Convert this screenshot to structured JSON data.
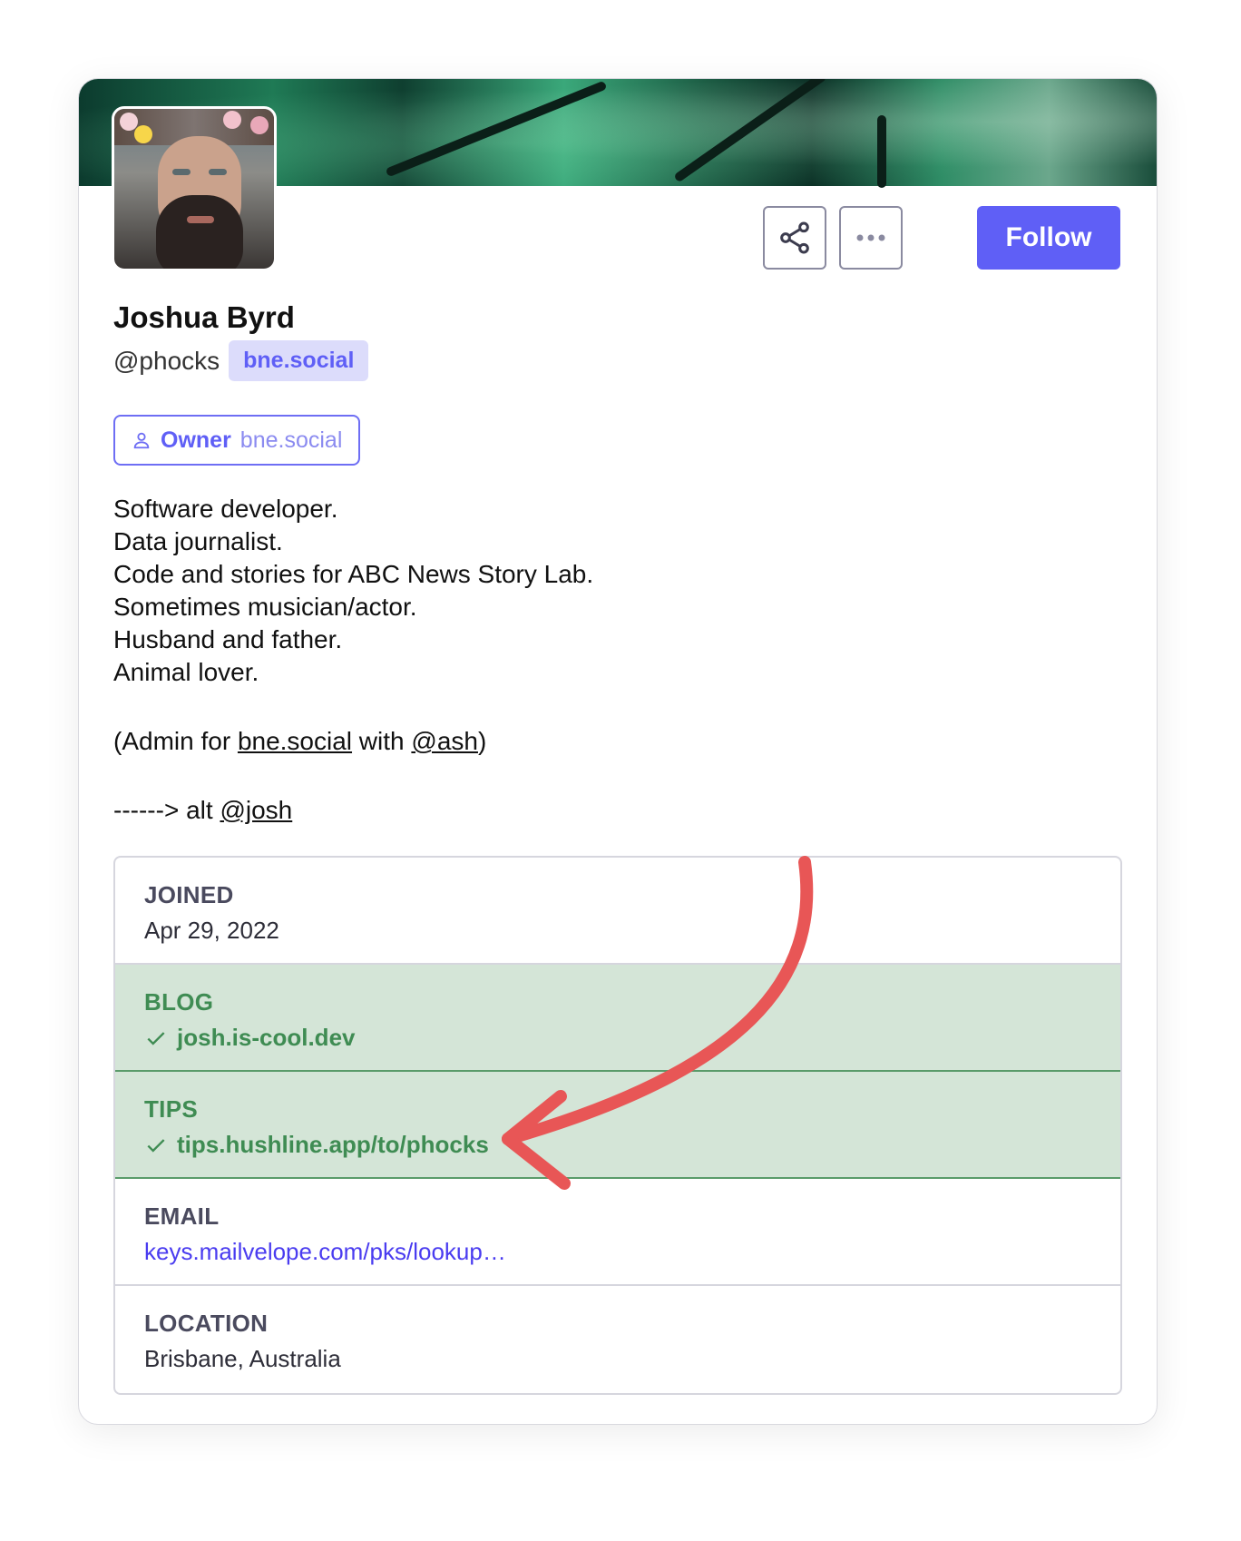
{
  "profile": {
    "display_name": "Joshua Byrd",
    "handle": "@phocks",
    "domain": "bne.social"
  },
  "actions": {
    "follow_label": "Follow",
    "share_icon": "share-icon",
    "more_icon": "more-icon"
  },
  "role": {
    "name": "Owner",
    "site": "bne.social"
  },
  "bio": {
    "lines": [
      "Software developer.",
      "Data journalist.",
      "Code and stories for ABC News Story Lab.",
      "Sometimes musician/actor.",
      "Husband and father.",
      "Animal lover."
    ],
    "admin_prefix": "(Admin for ",
    "admin_link": "bne.social",
    "admin_middle": " with ",
    "admin_mention": "@ash",
    "admin_suffix": ")",
    "alt_prefix": "------> alt ",
    "alt_mention": "@josh"
  },
  "fields": [
    {
      "label": "JOINED",
      "value": "Apr 29, 2022"
    },
    {
      "label": "BLOG",
      "value": "josh.is-cool.dev"
    },
    {
      "label": "TIPS",
      "value": "tips.hushline.app/to/phocks"
    },
    {
      "label": "EMAIL",
      "value": "keys.mailvelope.com/pks/lookup…"
    },
    {
      "label": "LOCATION",
      "value": "Brisbane, Australia"
    }
  ],
  "colors": {
    "accent": "#5f5ff6",
    "verified_bg": "#d4e5d7",
    "verified_text": "#3f8c53",
    "link": "#4a3cf0",
    "annotation_arrow": "#e85656"
  }
}
